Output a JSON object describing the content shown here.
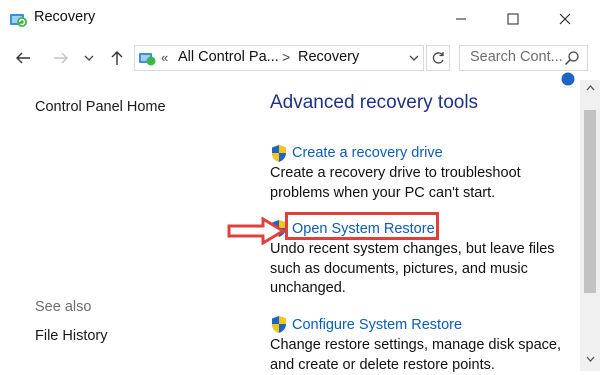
{
  "window": {
    "title": "Recovery",
    "minimize_icon": "minimize-icon",
    "maximize_icon": "maximize-icon",
    "close_icon": "close-icon"
  },
  "navigation": {
    "back_icon": "arrow-left-icon",
    "forward_icon": "arrow-right-icon",
    "recent_icon": "chevron-down-icon",
    "up_icon": "arrow-up-icon",
    "address": {
      "overflow": "«",
      "segments": [
        "All Control Pa...",
        "Recovery"
      ],
      "separator": ">"
    },
    "refresh_icon": "refresh-icon",
    "search": {
      "placeholder": "Search Cont...",
      "icon": "search-icon"
    }
  },
  "sidebar": {
    "home_link": "Control Panel Home",
    "see_also_label": "See also",
    "see_also_items": [
      "File History"
    ]
  },
  "main": {
    "heading": "Advanced recovery tools",
    "tasks": [
      {
        "label": "Create a recovery drive",
        "description": "Create a recovery drive to troubleshoot problems when your PC can't start.",
        "icon": "uac-shield-icon"
      },
      {
        "label": "Open System Restore",
        "description": "Undo recent system changes, but leave files such as documents, pictures, and music unchanged.",
        "icon": "uac-shield-icon",
        "highlighted": true
      },
      {
        "label": "Configure System Restore",
        "description": "Change restore settings, manage disk space, and create or delete restore points.",
        "icon": "uac-shield-icon"
      }
    ]
  },
  "colors": {
    "heading": "#1e3287",
    "link": "#0b5db8",
    "highlight": "#e0403c",
    "muted": "#6d6d6d"
  }
}
